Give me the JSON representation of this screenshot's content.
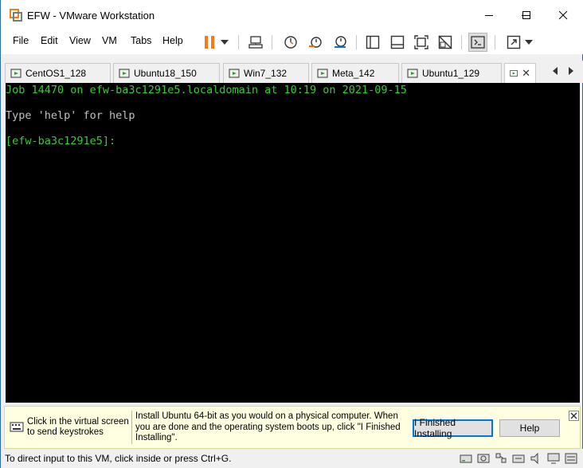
{
  "window": {
    "title": "EFW - VMware Workstation"
  },
  "menu": [
    "File",
    "Edit",
    "View",
    "VM",
    "Tabs",
    "Help"
  ],
  "toolbar_icons": [
    "pause-icon",
    "dropdown-icon",
    "send-ctrl-alt-del-icon",
    "snapshot-icon",
    "revert-snapshot-icon",
    "snapshot-manager-icon",
    "library-icon",
    "thumbnail-bar-icon",
    "fullscreen-icon",
    "unity-icon",
    "console-view-icon",
    "stretch-icon",
    "stretch-dropdown-icon"
  ],
  "tabs": [
    {
      "label": "CentOS1_128"
    },
    {
      "label": "Ubuntu18_150"
    },
    {
      "label": "Win7_132"
    },
    {
      "label": "Meta_142"
    },
    {
      "label": "Ubuntu1_129"
    },
    {
      "label": "",
      "active": true
    }
  ],
  "console": {
    "line1": "Job 14470 on efw-ba3c1291e5.localdomain at 10:19 on 2021-09-15",
    "line2": "Type 'help' for help",
    "line3": "[efw-ba3c1291e5]:",
    "colors": {
      "green": "#3cc83c",
      "gray": "#c0c0c0",
      "bg": "#000000"
    }
  },
  "infobar": {
    "hint": "Click in the virtual screen to send keystrokes",
    "message": "Install Ubuntu 64-bit as you would on a physical computer. When you are done and the operating system boots up, click \"I Finished Installing\".",
    "finished_label": "I Finished Installing",
    "help_label": "Help"
  },
  "status": {
    "text": "To direct input to this VM, click inside or press Ctrl+G."
  }
}
